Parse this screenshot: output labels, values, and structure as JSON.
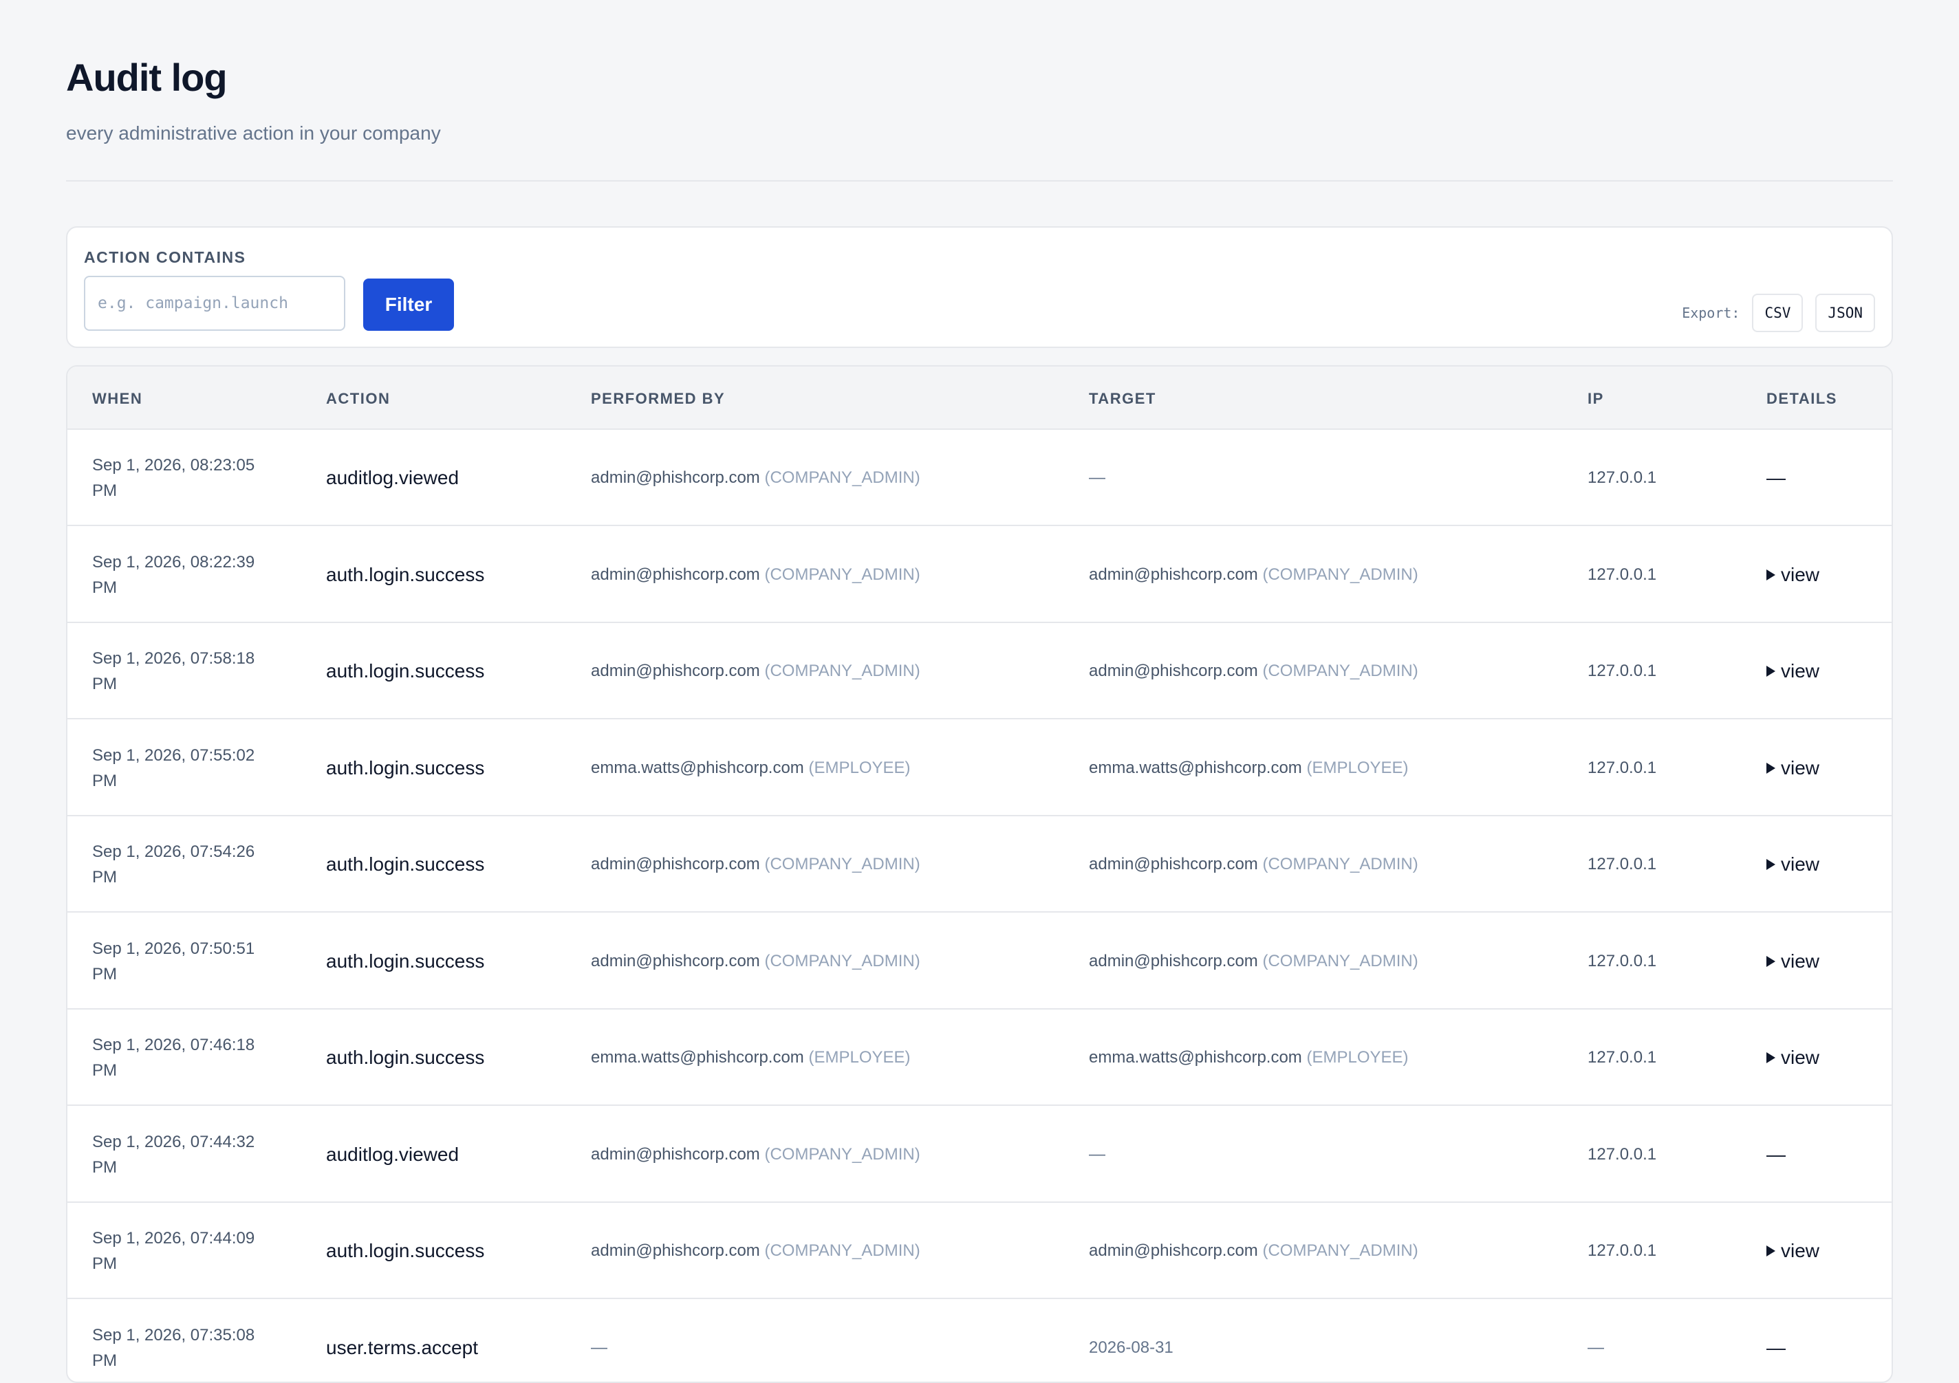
{
  "header": {
    "title": "Audit log",
    "subtitle": "every administrative action in your company"
  },
  "filter": {
    "label": "ACTION CONTAINS",
    "placeholder": "e.g. campaign.launch",
    "value": "",
    "button_label": "Filter"
  },
  "export": {
    "label": "Export:",
    "csv_label": "CSV",
    "json_label": "JSON"
  },
  "table": {
    "columns": [
      "WHEN",
      "ACTION",
      "PERFORMED BY",
      "TARGET",
      "IP",
      "DETAILS"
    ],
    "rows": [
      {
        "when": "Sep 1, 2026, 08:23:05 PM",
        "action": "auditlog.viewed",
        "by_email": "admin@phishcorp.com",
        "by_role": "(COMPANY_ADMIN)",
        "target_email": "—",
        "target_role": "",
        "ip": "127.0.0.1",
        "details": "—"
      },
      {
        "when": "Sep 1, 2026, 08:22:39 PM",
        "action": "auth.login.success",
        "by_email": "admin@phishcorp.com",
        "by_role": "(COMPANY_ADMIN)",
        "target_email": "admin@phishcorp.com",
        "target_role": "(COMPANY_ADMIN)",
        "ip": "127.0.0.1",
        "details": "view"
      },
      {
        "when": "Sep 1, 2026, 07:58:18 PM",
        "action": "auth.login.success",
        "by_email": "admin@phishcorp.com",
        "by_role": "(COMPANY_ADMIN)",
        "target_email": "admin@phishcorp.com",
        "target_role": "(COMPANY_ADMIN)",
        "ip": "127.0.0.1",
        "details": "view"
      },
      {
        "when": "Sep 1, 2026, 07:55:02 PM",
        "action": "auth.login.success",
        "by_email": "emma.watts@phishcorp.com",
        "by_role": "(EMPLOYEE)",
        "target_email": "emma.watts@phishcorp.com",
        "target_role": "(EMPLOYEE)",
        "ip": "127.0.0.1",
        "details": "view"
      },
      {
        "when": "Sep 1, 2026, 07:54:26 PM",
        "action": "auth.login.success",
        "by_email": "admin@phishcorp.com",
        "by_role": "(COMPANY_ADMIN)",
        "target_email": "admin@phishcorp.com",
        "target_role": "(COMPANY_ADMIN)",
        "ip": "127.0.0.1",
        "details": "view"
      },
      {
        "when": "Sep 1, 2026, 07:50:51 PM",
        "action": "auth.login.success",
        "by_email": "admin@phishcorp.com",
        "by_role": "(COMPANY_ADMIN)",
        "target_email": "admin@phishcorp.com",
        "target_role": "(COMPANY_ADMIN)",
        "ip": "127.0.0.1",
        "details": "view"
      },
      {
        "when": "Sep 1, 2026, 07:46:18 PM",
        "action": "auth.login.success",
        "by_email": "emma.watts@phishcorp.com",
        "by_role": "(EMPLOYEE)",
        "target_email": "emma.watts@phishcorp.com",
        "target_role": "(EMPLOYEE)",
        "ip": "127.0.0.1",
        "details": "view"
      },
      {
        "when": "Sep 1, 2026, 07:44:32 PM",
        "action": "auditlog.viewed",
        "by_email": "admin@phishcorp.com",
        "by_role": "(COMPANY_ADMIN)",
        "target_email": "—",
        "target_role": "",
        "ip": "127.0.0.1",
        "details": "—"
      },
      {
        "when": "Sep 1, 2026, 07:44:09 PM",
        "action": "auth.login.success",
        "by_email": "admin@phishcorp.com",
        "by_role": "(COMPANY_ADMIN)",
        "target_email": "admin@phishcorp.com",
        "target_role": "(COMPANY_ADMIN)",
        "ip": "127.0.0.1",
        "details": "view"
      },
      {
        "when": "Sep 1, 2026, 07:35:08 PM",
        "action": "user.terms.accept",
        "by_email": "—",
        "by_role": "",
        "target_email": "2026-08-31",
        "target_role": "",
        "ip": "—",
        "details": "—"
      }
    ]
  },
  "icons": {
    "details_expand": "triangle-right-icon"
  },
  "colors": {
    "primary": "#1d4ed8",
    "background": "#f5f6f8",
    "text": "#0f172a",
    "muted": "#475569",
    "role_muted": "#94a3b8"
  }
}
